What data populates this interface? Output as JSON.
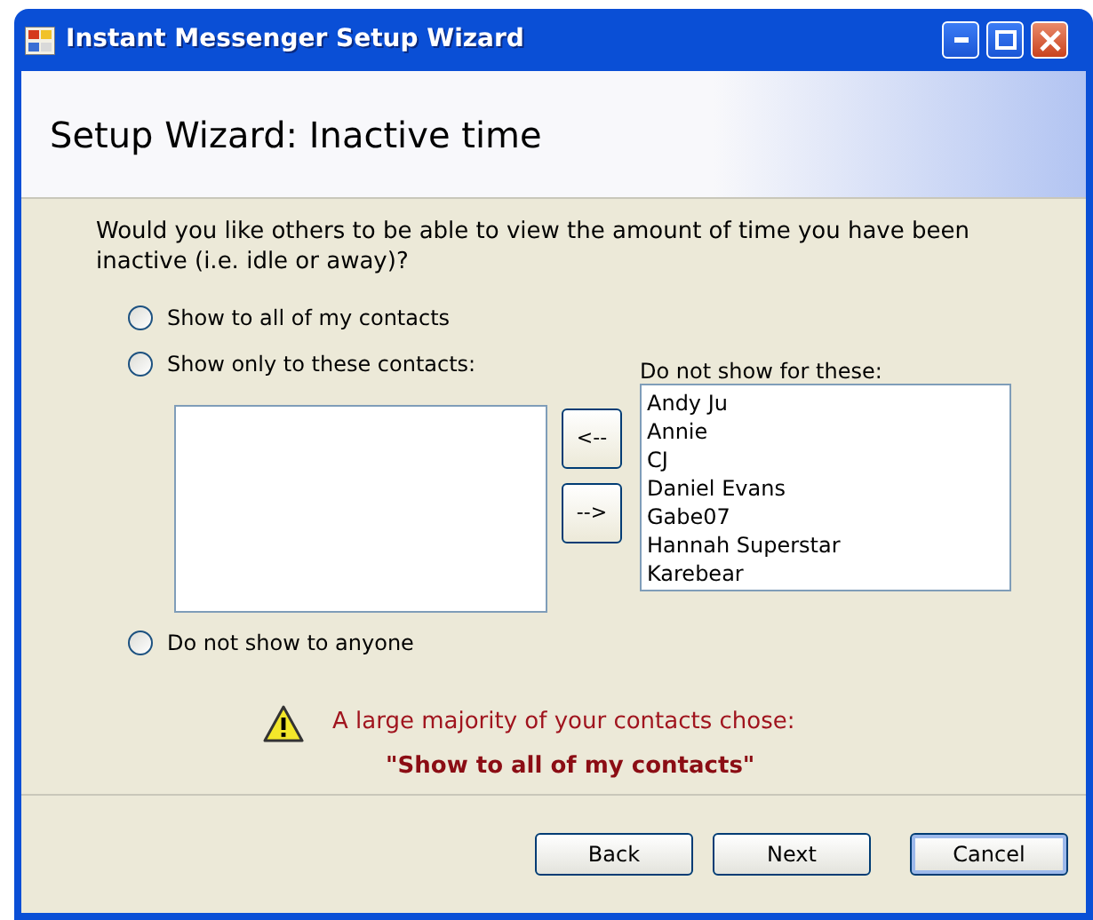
{
  "window": {
    "title": "Instant Messenger Setup Wizard"
  },
  "header": {
    "title": "Setup Wizard: Inactive time"
  },
  "question": "Would you like others to be able to view the amount of time you have been inactive (i.e. idle or away)?",
  "options": [
    {
      "label": "Show to all of my contacts",
      "selected": false
    },
    {
      "label": "Show only to these contacts:",
      "selected": false
    },
    {
      "label": "Do not show to anyone",
      "selected": false
    }
  ],
  "move_buttons": [
    "<--",
    "-->"
  ],
  "hidden_list": {
    "label": "Do not show for these:",
    "items": [
      "Andy Ju",
      "Annie",
      "CJ",
      "Daniel Evans",
      "Gabe07",
      "Hannah Superstar",
      "Karebear"
    ]
  },
  "notice": {
    "text": "A large majority of your contacts chose:",
    "choice": "\"Show to all of my contacts\""
  },
  "buttons": [
    {
      "label": "Back",
      "default": false
    },
    {
      "label": "Next",
      "default": false
    },
    {
      "label": "Cancel",
      "default": true
    }
  ]
}
